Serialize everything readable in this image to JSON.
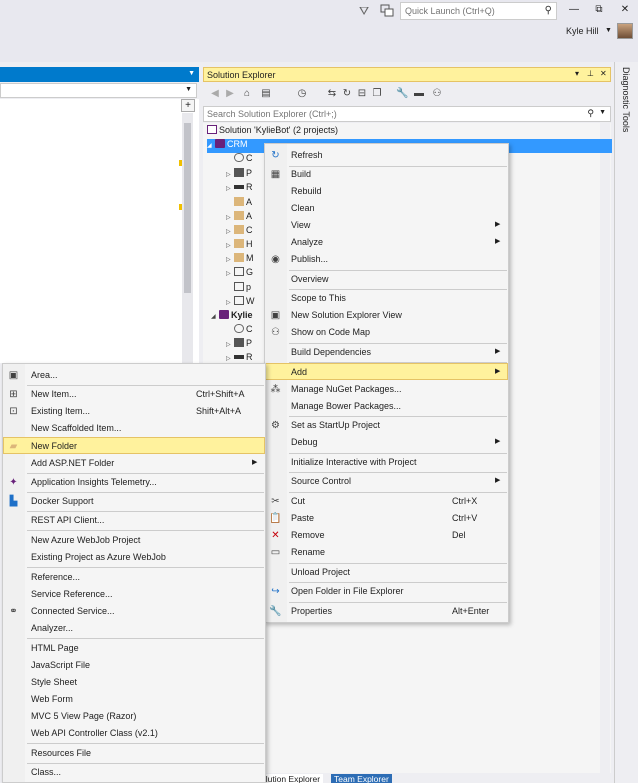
{
  "titlebar": {
    "quick_launch_placeholder": "Quick Launch (Ctrl+Q)",
    "user_name": "Kyle Hill",
    "minimize": "—",
    "maximize": "⧉",
    "close": "✕"
  },
  "solution_explorer": {
    "title": "Solution Explorer",
    "search_placeholder": "Search Solution Explorer (Ctrl+;)",
    "tree": [
      {
        "label": "Solution 'KylieBot' (2 projects)"
      },
      {
        "label": "CRM"
      },
      {
        "label": "C"
      },
      {
        "label": "P"
      },
      {
        "label": "R"
      },
      {
        "label": "A"
      },
      {
        "label": "A"
      },
      {
        "label": "C"
      },
      {
        "label": "H"
      },
      {
        "label": "M"
      },
      {
        "label": "G"
      },
      {
        "label": "p"
      },
      {
        "label": "W"
      },
      {
        "label": "Kylie"
      },
      {
        "label": "C"
      },
      {
        "label": "P"
      },
      {
        "label": "R"
      }
    ],
    "bottom_tabs": [
      "olution Explorer",
      "Team Explorer"
    ]
  },
  "diagnostic_tools_label": "Diagnostic Tools",
  "project_menu": {
    "items": [
      {
        "label": "Refresh",
        "icon": "refresh-icon"
      },
      {
        "label": "Build",
        "icon": "build-icon"
      },
      {
        "label": "Rebuild"
      },
      {
        "label": "Clean"
      },
      {
        "label": "View"
      },
      {
        "label": "Analyze"
      },
      {
        "label": "Publish...",
        "icon": "publish-icon"
      },
      {
        "label": "Overview"
      },
      {
        "label": "Scope to This"
      },
      {
        "label": "New Solution Explorer View",
        "icon": "new-view-icon"
      },
      {
        "label": "Show on Code Map",
        "icon": "code-map-icon"
      },
      {
        "label": "Build Dependencies"
      },
      {
        "label": "Add"
      },
      {
        "label": "Manage NuGet Packages...",
        "icon": "nuget-icon"
      },
      {
        "label": "Manage Bower Packages..."
      },
      {
        "label": "Set as StartUp Project",
        "icon": "gear-icon"
      },
      {
        "label": "Debug"
      },
      {
        "label": "Initialize Interactive with Project"
      },
      {
        "label": "Source Control"
      },
      {
        "label": "Cut",
        "shortcut": "Ctrl+X",
        "icon": "scissors-icon"
      },
      {
        "label": "Paste",
        "shortcut": "Ctrl+V",
        "icon": "paste-icon"
      },
      {
        "label": "Remove",
        "shortcut": "Del",
        "icon": "remove-icon"
      },
      {
        "label": "Rename",
        "icon": "rename-icon"
      },
      {
        "label": "Unload Project"
      },
      {
        "label": "Open Folder in File Explorer",
        "icon": "open-folder-icon"
      },
      {
        "label": "Properties",
        "shortcut": "Alt+Enter",
        "icon": "wrench-icon"
      }
    ]
  },
  "add_menu": {
    "items": [
      {
        "label": "Area...",
        "icon": "area-icon"
      },
      {
        "label": "New Item...",
        "shortcut": "Ctrl+Shift+A",
        "icon": "new-item-icon"
      },
      {
        "label": "Existing Item...",
        "shortcut": "Shift+Alt+A",
        "icon": "existing-item-icon"
      },
      {
        "label": "New Scaffolded Item..."
      },
      {
        "label": "New Folder",
        "icon": "new-folder-icon"
      },
      {
        "label": "Add ASP.NET Folder"
      },
      {
        "label": "Application Insights Telemetry...",
        "icon": "insights-icon"
      },
      {
        "label": "Docker Support",
        "icon": "docker-icon"
      },
      {
        "label": "REST API Client..."
      },
      {
        "label": "New Azure WebJob Project"
      },
      {
        "label": "Existing Project as Azure WebJob"
      },
      {
        "label": "Reference..."
      },
      {
        "label": "Service Reference..."
      },
      {
        "label": "Connected Service...",
        "icon": "connected-service-icon"
      },
      {
        "label": "Analyzer..."
      },
      {
        "label": "HTML Page"
      },
      {
        "label": "JavaScript File"
      },
      {
        "label": "Style Sheet"
      },
      {
        "label": "Web Form"
      },
      {
        "label": "MVC 5 View Page (Razor)"
      },
      {
        "label": "Web API Controller Class (v2.1)"
      },
      {
        "label": "Resources File"
      },
      {
        "label": "Class..."
      }
    ]
  }
}
